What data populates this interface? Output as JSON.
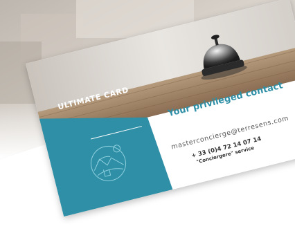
{
  "card": {
    "label": "ULTIMATE CARD",
    "contact_title": "Your privileged contact",
    "email": "masterconcierge@terresens.com",
    "phone": "+ 33 (0)4 72 14 07 14",
    "service": "\"Conciergere\" service"
  },
  "colors": {
    "teal": "#2f8fa6",
    "text_dark": "#333333",
    "text_grey": "#555555",
    "background": "#ffffff"
  },
  "icons": {
    "emblem": "globe-landscape-icon",
    "bell": "service-bell"
  }
}
